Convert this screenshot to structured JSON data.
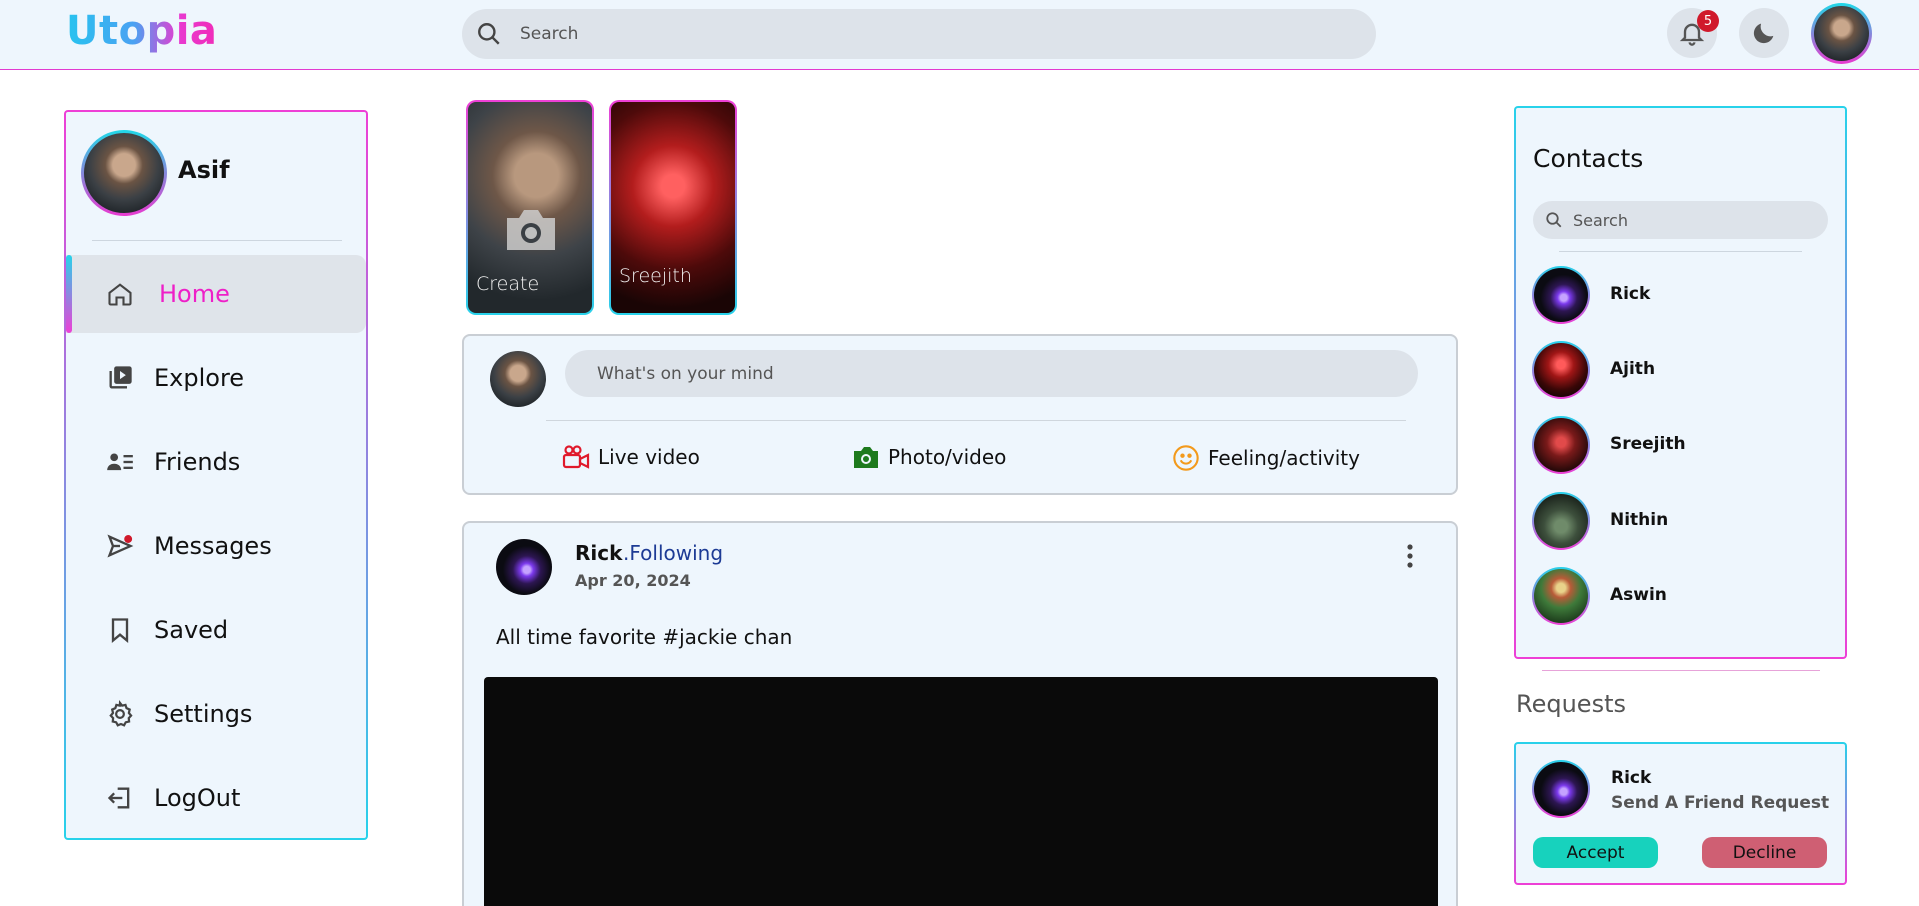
{
  "app": {
    "logo": "Utopia"
  },
  "header": {
    "search_placeholder": "Search",
    "notification_count": "5",
    "icons": [
      "search-icon",
      "bell-icon",
      "moon-icon",
      "avatar"
    ]
  },
  "sidebar": {
    "profile_name": "Asif",
    "items": [
      {
        "label": "Home",
        "icon": "home-icon",
        "active": true
      },
      {
        "label": "Explore",
        "icon": "explore-icon"
      },
      {
        "label": "Friends",
        "icon": "friends-icon"
      },
      {
        "label": "Messages",
        "icon": "messages-icon"
      },
      {
        "label": "Saved",
        "icon": "bookmark-icon"
      },
      {
        "label": "Settings",
        "icon": "gear-icon"
      },
      {
        "label": "LogOut",
        "icon": "logout-icon"
      }
    ]
  },
  "stories": [
    {
      "label": "Create"
    },
    {
      "label": "Sreejith"
    }
  ],
  "composer": {
    "placeholder": "What's on your mind",
    "actions": [
      {
        "label": "Live video",
        "icon": "video-camera-icon",
        "color": "#e0192b"
      },
      {
        "label": "Photo/video",
        "icon": "camera-icon",
        "color": "#1d7a1d"
      },
      {
        "label": "Feeling/activity",
        "icon": "smile-icon",
        "color": "#f39a1c"
      }
    ]
  },
  "post": {
    "author": "Rick",
    "follow_label": ".Following",
    "date": "Apr 20, 2024",
    "text": "All time favorite #jackie chan"
  },
  "contacts": {
    "title": "Contacts",
    "search_placeholder": "Search",
    "items": [
      {
        "name": "Rick"
      },
      {
        "name": "Ajith"
      },
      {
        "name": "Sreejith"
      },
      {
        "name": "Nithin"
      },
      {
        "name": "Aswin"
      }
    ]
  },
  "requests": {
    "title": "Requests",
    "item": {
      "name": "Rick",
      "subtitle": "Send A Friend Request",
      "accept_label": "Accept",
      "decline_label": "Decline"
    }
  },
  "colors": {
    "accent_pink": "#ee20c8",
    "accent_cyan": "#27d2ea",
    "card_bg": "#eef6fd",
    "input_bg": "#dde3ea",
    "accept": "#17d2bd",
    "decline": "#cf5f73"
  }
}
